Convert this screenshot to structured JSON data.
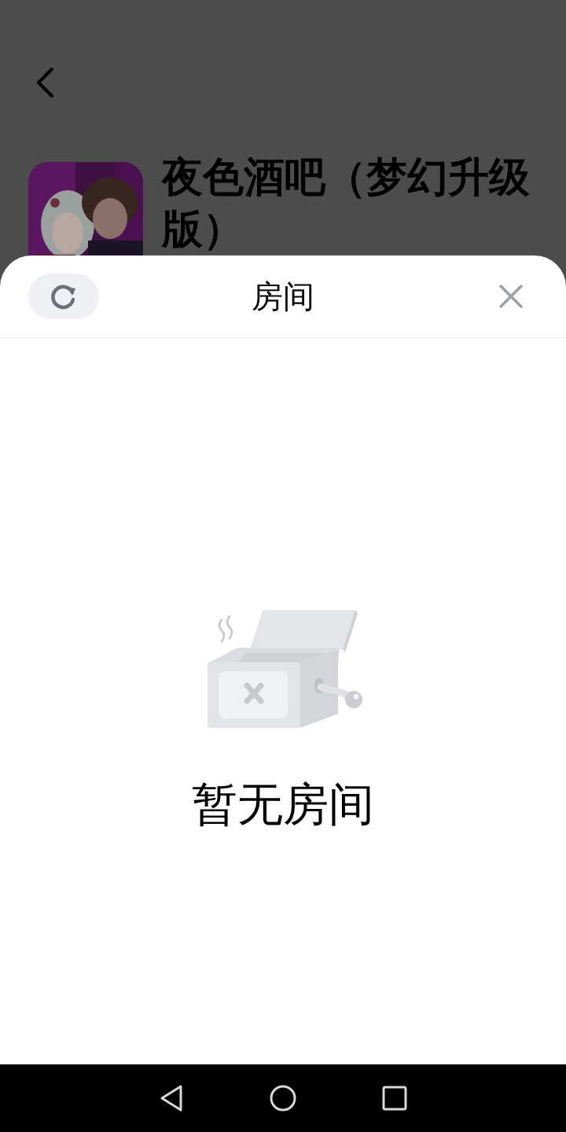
{
  "page": {
    "title": "夜色酒吧（梦幻升级版）"
  },
  "sheet": {
    "title": "房间"
  },
  "empty_state": {
    "text": "暂无房间"
  }
}
